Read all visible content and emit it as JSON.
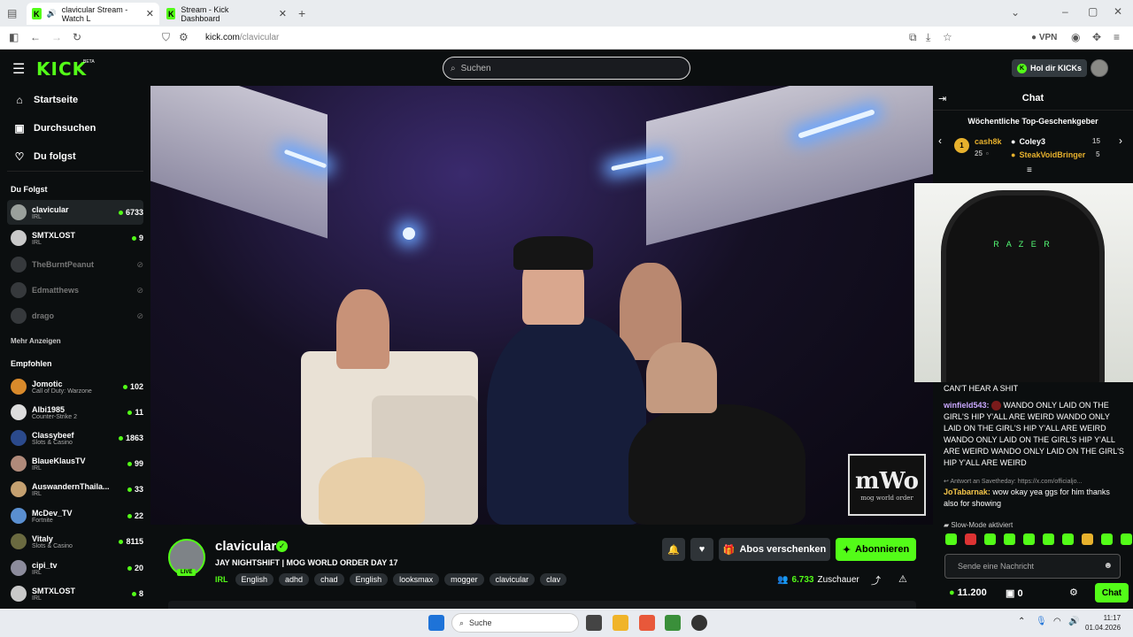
{
  "browser": {
    "tabs": [
      {
        "label": "clavicular Stream - Watch L"
      },
      {
        "label": "Stream - Kick Dashboard"
      }
    ],
    "url_host": "kick.com",
    "url_path": "/clavicular",
    "vpn_label": "VPN"
  },
  "kick": {
    "logo": "KICK",
    "logo_badge": "BETA",
    "search_placeholder": "Suchen",
    "get_kicks_label": "Hol dir KICKs",
    "brand_color": "#53fc18"
  },
  "sidebar": {
    "nav": [
      {
        "label": "Startseite",
        "icon": "home-icon"
      },
      {
        "label": "Durchsuchen",
        "icon": "browse-icon"
      },
      {
        "label": "Du folgst",
        "icon": "heart-icon"
      }
    ],
    "following_title": "Du Folgst",
    "following": [
      {
        "name": "clavicular",
        "category": "IRL",
        "viewers": "6733"
      },
      {
        "name": "SMTXLOST",
        "category": "IRL",
        "viewers": "9"
      },
      {
        "name": "TheBurntPeanut"
      },
      {
        "name": "Edmatthews"
      },
      {
        "name": "drago"
      }
    ],
    "show_more": "Mehr Anzeigen",
    "recommended_title": "Empfohlen",
    "recommended": [
      {
        "name": "Jomotic",
        "category": "Call of Duty: Warzone",
        "viewers": "102"
      },
      {
        "name": "Albi1985",
        "category": "Counter-Strike 2",
        "viewers": "11"
      },
      {
        "name": "Classybeef",
        "category": "Slots & Casino",
        "viewers": "1863"
      },
      {
        "name": "BlaueKlausTV",
        "category": "IRL",
        "viewers": "99"
      },
      {
        "name": "AuswandernThaila...",
        "category": "IRL",
        "viewers": "33"
      },
      {
        "name": "McDev_TV",
        "category": "Fortnite",
        "viewers": "22"
      },
      {
        "name": "Vitaly",
        "category": "Slots & Casino",
        "viewers": "8115"
      },
      {
        "name": "cipi_tv",
        "category": "IRL",
        "viewers": "20"
      },
      {
        "name": "SMTXLOST",
        "category": "IRL",
        "viewers": "8"
      }
    ]
  },
  "video": {
    "watermark_big": "mWo",
    "watermark_small": "mog world order"
  },
  "stream": {
    "streamer": "clavicular",
    "live": "LIVE",
    "title": "JAY NIGHTSHIFT | MOG WORLD ORDER DAY 17",
    "category": "IRL",
    "tags": [
      "English",
      "adhd",
      "chad",
      "English",
      "looksmax",
      "mogger",
      "clavicular",
      "clav"
    ],
    "gift_label": "Abos verschenken",
    "subscribe_label": "Abonnieren",
    "viewers": "6.733",
    "viewers_label": "Zuschauer"
  },
  "chat": {
    "title": "Chat",
    "gifters_title": "Wöchentliche Top-Geschenkgeber",
    "gifters": [
      {
        "name": "cash8k",
        "count": "25",
        "rank": "1"
      },
      {
        "name": "Coley3",
        "count": "15"
      },
      {
        "name": "SteakVoidBringer",
        "count": "5"
      }
    ],
    "messages": [
      {
        "user": "",
        "text": "CAN'T HEAR A SHIT"
      },
      {
        "user": "winfield543:",
        "text": "WANDO ONLY LAID ON THE GIRL'S HIP Y'ALL ARE WEIRD WANDO ONLY LAID ON THE GIRL'S HIP Y'ALL ARE WEIRD WANDO ONLY LAID ON THE GIRL'S HIP Y'ALL ARE WEIRD WANDO ONLY LAID ON THE GIRL'S HIP Y'ALL ARE WEIRD"
      },
      {
        "user": "JoTabarnak:",
        "text": "wow okay yea ggs for him thanks also for showing"
      }
    ],
    "reply_prefix": "Antwort an Savetheday: https://x.com/officialjo...",
    "slow_mode": "Slow-Mode aktiviert",
    "input_placeholder": "Sende eine Nachricht",
    "kicks_balance": "11.200",
    "sub_balance": "0",
    "send_label": "Chat"
  },
  "taskbar": {
    "search_label": "Suche",
    "time": "11:17",
    "date": "01.04.2026"
  }
}
